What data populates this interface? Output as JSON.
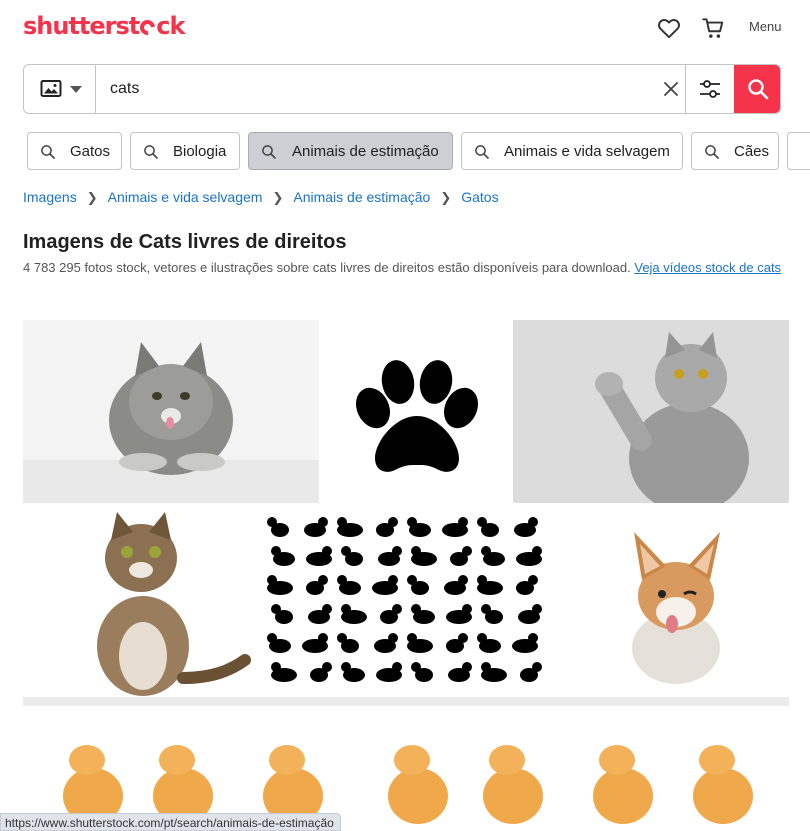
{
  "header": {
    "logo_text_a": "shutterst",
    "logo_text_b": "ck",
    "menu_label": "Menu"
  },
  "search": {
    "query": "cats"
  },
  "chips": [
    {
      "label": "Gatos"
    },
    {
      "label": "Biologia"
    },
    {
      "label": "Animais de estimação"
    },
    {
      "label": "Animais e vida selvagem"
    },
    {
      "label": "Cães"
    }
  ],
  "breadcrumb": [
    "Imagens",
    "Animais e vida selvagem",
    "Animais de estimação",
    "Gatos"
  ],
  "page": {
    "title": "Imagens de Cats livres de direitos",
    "subtitle": "4 783 295 fotos stock, vetores e ilustrações sobre cats livres de direitos estão disponíveis para download.",
    "video_link": "Veja vídeos stock de cats"
  },
  "status_bar": {
    "url": "https://www.shutterstock.com/pt/search/animais-de-estimação"
  },
  "colors": {
    "brand": "#f5334a",
    "link": "#1a73c8"
  }
}
